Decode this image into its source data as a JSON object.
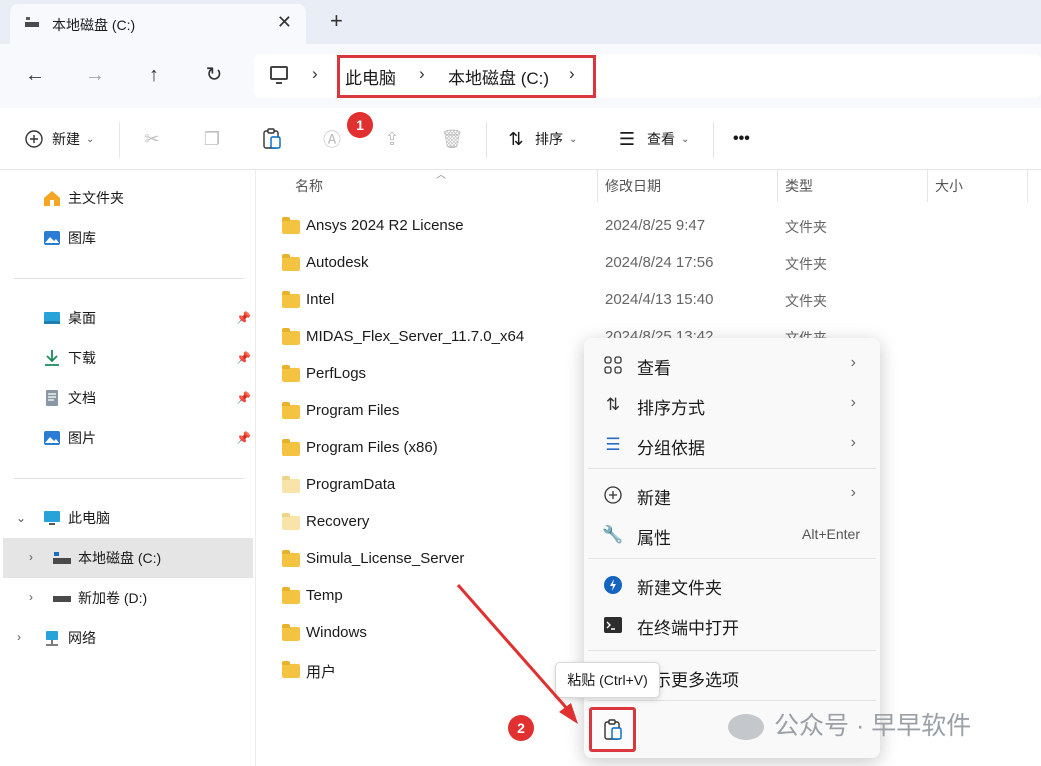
{
  "tab": {
    "title": "本地磁盘 (C:)",
    "close": "✕",
    "new": "+"
  },
  "nav": {
    "back": "←",
    "forward": "→",
    "up": "↑",
    "refresh": "↻"
  },
  "breadcrumb": {
    "sep": "›",
    "items": [
      "此电脑",
      "本地磁盘 (C:)"
    ]
  },
  "toolbar": {
    "new_label": "新建",
    "sort_label": "排序",
    "view_label": "查看",
    "more": "•••"
  },
  "badges": {
    "one": "1",
    "two": "2"
  },
  "sidebar": {
    "home": "主文件夹",
    "gallery": "图库",
    "desktop": "桌面",
    "downloads": "下载",
    "documents": "文档",
    "pictures": "图片",
    "this_pc": "此电脑",
    "local_c": "本地磁盘 (C:)",
    "new_d": "新加卷 (D:)",
    "network": "网络"
  },
  "columns": {
    "name": "名称",
    "modified": "修改日期",
    "type": "类型",
    "size": "大小"
  },
  "files": [
    {
      "name": "Ansys 2024 R2 License",
      "date": "2024/8/25 9:47",
      "type": "文件夹"
    },
    {
      "name": "Autodesk",
      "date": "2024/8/24 17:56",
      "type": "文件夹"
    },
    {
      "name": "Intel",
      "date": "2024/4/13 15:40",
      "type": "文件夹"
    },
    {
      "name": "MIDAS_Flex_Server_11.7.0_x64",
      "date": "2024/8/25 13:42",
      "type": "文件夹"
    },
    {
      "name": "PerfLogs",
      "date": "",
      "type": ""
    },
    {
      "name": "Program Files",
      "date": "",
      "type": ""
    },
    {
      "name": "Program Files (x86)",
      "date": "",
      "type": ""
    },
    {
      "name": "ProgramData",
      "date": "",
      "type": ""
    },
    {
      "name": "Recovery",
      "date": "",
      "type": ""
    },
    {
      "name": "Simula_License_Server",
      "date": "",
      "type": ""
    },
    {
      "name": "Temp",
      "date": "",
      "type": ""
    },
    {
      "name": "Windows",
      "date": "",
      "type": ""
    },
    {
      "name": "用户",
      "date": "",
      "type": ""
    }
  ],
  "context_menu": {
    "view": "查看",
    "sort_by": "排序方式",
    "group_by": "分组依据",
    "new": "新建",
    "properties": "属性",
    "properties_shortcut": "Alt+Enter",
    "new_folder": "新建文件夹",
    "open_terminal": "在终端中打开",
    "more_options": "显示更多选项",
    "arrow": "›"
  },
  "tooltip": "粘贴 (Ctrl+V)",
  "watermark": "公众号 · 早早软件",
  "colors": {
    "accent": "#0067c0",
    "highlight": "#d9363e",
    "folder": "#f5c342"
  }
}
